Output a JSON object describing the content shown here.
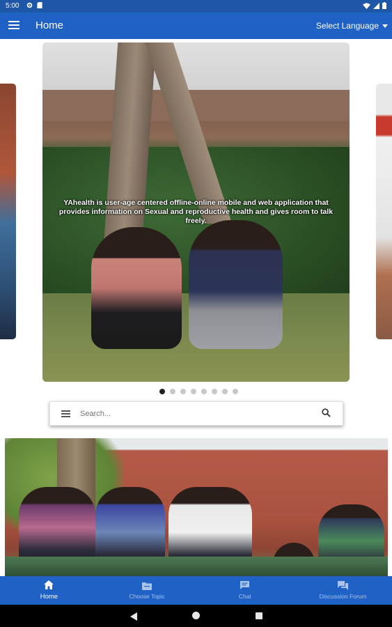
{
  "status_bar": {
    "time": "5:00",
    "left_icons": [
      "gear-icon",
      "sim-icon"
    ],
    "right_icons": [
      "wifi-icon",
      "signal-icon",
      "battery-icon"
    ]
  },
  "app_bar": {
    "menu_icon": "hamburger-menu-icon",
    "title": "Home",
    "language_selector": "Select Language"
  },
  "carousel": {
    "caption": "YAhealth is user-age centered offline-online mobile and web application that provides information on Sexual and reproductive health and gives room to talk freely.",
    "slide_count": 8,
    "active_slide": 1
  },
  "search": {
    "placeholder": "Search...",
    "value": ""
  },
  "bottom_nav": {
    "items": [
      {
        "label": "Home",
        "icon": "home-icon",
        "active": true
      },
      {
        "label": "Choose Topic",
        "icon": "folder-icon",
        "active": false
      },
      {
        "label": "Chat",
        "icon": "chat-bubble-icon",
        "active": false
      },
      {
        "label": "Discussion Forum",
        "icon": "forum-icon",
        "active": false
      }
    ]
  },
  "colors": {
    "primary": "#1f61c4",
    "status_bar": "#1e57a8",
    "inactive_tab": "#a9c3ea",
    "active_tab": "#ffffff"
  }
}
